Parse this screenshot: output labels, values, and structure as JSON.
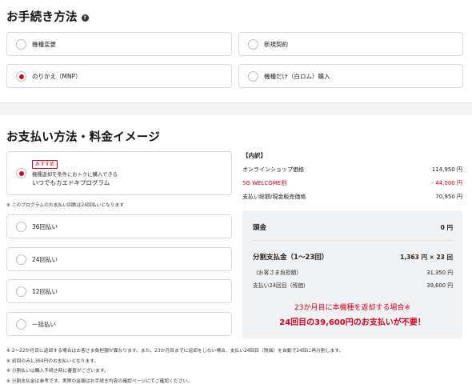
{
  "procedure": {
    "title": "お手続き方法",
    "help_glyph": "?",
    "options": [
      {
        "label": "機種変更",
        "selected": false
      },
      {
        "label": "新規契約",
        "selected": false
      },
      {
        "label": "のりかえ（MNP）",
        "selected": true
      },
      {
        "label": "機種だけ（白ロム）購入",
        "selected": false
      }
    ]
  },
  "payment": {
    "title": "お支払い方法・料金イメージ",
    "program": {
      "badge": "おすすめ",
      "line1": "機種返却を条件におトクに購入できる",
      "line2": "いつでもカエドキプログラム",
      "selected": true
    },
    "program_note": "※ このプログラムのお支払い回数は24回払いとなります",
    "options": [
      {
        "label": "36回払い",
        "selected": false
      },
      {
        "label": "24回払い",
        "selected": false
      },
      {
        "label": "12回払い",
        "selected": false
      },
      {
        "label": "一括払い",
        "selected": false
      }
    ]
  },
  "breakdown": {
    "heading": "【内訳】",
    "rows": [
      {
        "label": "オンラインショップ価格",
        "value": "114,950 円",
        "highlight": false
      },
      {
        "label": "5G WELCOME割",
        "value": "- 44,000 円",
        "highlight": true
      },
      {
        "label": "支払い総額/現金販売価格",
        "value": "70,950 円",
        "highlight": false
      }
    ]
  },
  "summary": {
    "down_payment_label": "頭金",
    "down_payment_value": "0 円",
    "installment_label": "分割支払金（1〜23回）",
    "installment_value": "1,363 円 × 23 回",
    "customer_burden_label": "（お客さま負担額）",
    "customer_burden_value": "31,350 円",
    "final_payment_label": "支払い24回目（残価）",
    "final_payment_value": "39,600 円",
    "return_line1": "23か月目に本機種を返却する場合※",
    "return_line2": "24回目の39,600円のお支払いが不要！"
  },
  "footnotes": [
    "※ 2〜22か月目に返却する場合はお客さま負担額が異なります。また、23か月目までに返却をしない場合、支払い24回目（残価）を自動で24回に再分割します。",
    "※ 初回のみ1,364円のお支払いとなります。",
    "※ 分割払いは購入手続き時に審査がございます。",
    "※ 分割支払金は参考です。実際の金額はお手続き内容の確認ページにてご確認ください。"
  ],
  "colors": {
    "accent": "#d6001c",
    "panel_bg": "#f1f2f4",
    "border": "#d9d9d9"
  }
}
